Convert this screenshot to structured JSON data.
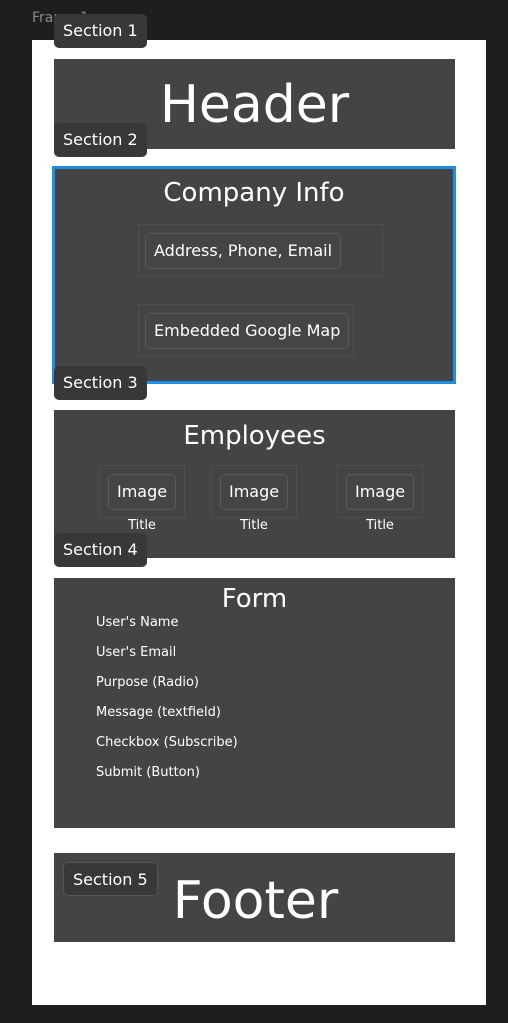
{
  "canvas": {
    "frame_label": "Frame 1"
  },
  "sections": {
    "section1": {
      "tag": "Section 1",
      "title": "Header"
    },
    "section2": {
      "tag": "Section 2",
      "title": "Company Info",
      "items": [
        "Address, Phone, Email",
        "Embedded Google Map"
      ]
    },
    "section3": {
      "tag": "Section 3",
      "title": "Employees",
      "cards": [
        {
          "image": "Image",
          "caption": "Title"
        },
        {
          "image": "Image",
          "caption": "Title"
        },
        {
          "image": "Image",
          "caption": "Title"
        }
      ]
    },
    "section4": {
      "tag": "Section 4",
      "title": "Form",
      "fields": [
        "User's Name",
        "User's Email",
        "Purpose (Radio)",
        "Message (textfield)",
        "Checkbox (Subscribe)",
        "Submit (Button)"
      ]
    },
    "section5": {
      "tag": "Section 5",
      "title": "Footer"
    }
  },
  "colors": {
    "canvas_bg": "#1e1e1e",
    "frame_bg": "#ffffff",
    "panel_bg": "#444444",
    "tag_bg": "#383838",
    "selection": "#1e8fe3"
  }
}
